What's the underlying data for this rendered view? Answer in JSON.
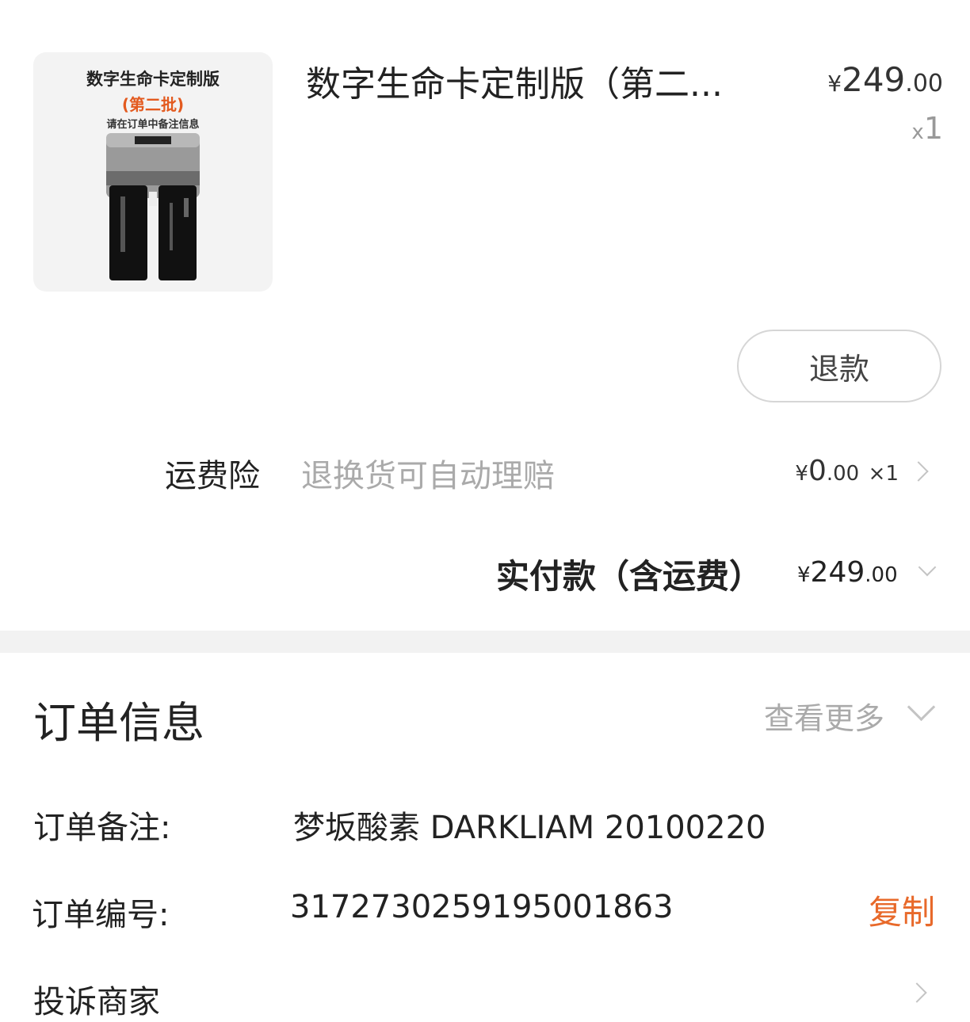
{
  "product": {
    "image": {
      "title": "数字生命卡定制版",
      "batch": "(第二批)",
      "note": "请在订单中备注信息"
    },
    "title": "数字生命卡定制版（第二...",
    "price": {
      "currency": "¥",
      "integer": "249",
      "decimal": ".00"
    },
    "quantity": {
      "prefix": "x",
      "value": "1"
    }
  },
  "refund_button": "退款",
  "shipping_insurance": {
    "label": "运费险",
    "description": "退换货可自动理赔",
    "price": {
      "currency": "¥",
      "integer": "0",
      "decimal": ".00",
      "multiplier": "×1"
    }
  },
  "total": {
    "label": "实付款（含运费）",
    "currency": "¥",
    "integer": "249",
    "decimal": ".00"
  },
  "order_info": {
    "title": "订单信息",
    "see_more": "查看更多",
    "remark_label": "订单备注:",
    "remark_value": "梦坂酸素 DARKLIAM 20100220",
    "number_label": "订单编号:",
    "number_value": "3172730259195001863",
    "copy": "复制",
    "complaint": "投诉商家"
  },
  "colors": {
    "accent": "#e8692a",
    "muted": "#aaaaaa",
    "divider": "#f2f2f2"
  }
}
